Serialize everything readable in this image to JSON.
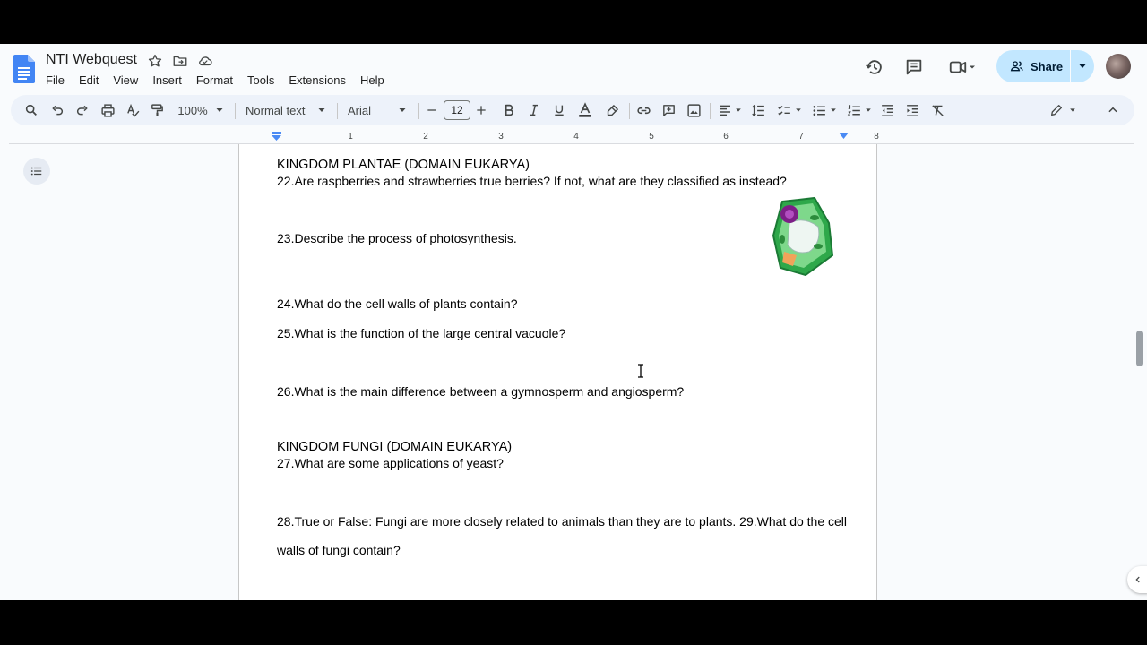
{
  "document": {
    "title": "NTI Webquest"
  },
  "menu": [
    "File",
    "Edit",
    "View",
    "Insert",
    "Format",
    "Tools",
    "Extensions",
    "Help"
  ],
  "header": {
    "share_label": "Share"
  },
  "toolbar": {
    "zoom": "100%",
    "style": "Normal text",
    "font": "Arial",
    "font_size": "12"
  },
  "ruler": {
    "labels": [
      "1",
      "2",
      "3",
      "4",
      "5",
      "6",
      "7",
      "8"
    ]
  },
  "content": {
    "plantae_heading": "KINGDOM PLANTAE (DOMAIN EUKARYA)",
    "q22": "22.Are raspberries and strawberries true berries? If not, what are they classified as instead?",
    "q23": "23.Describe the process of photosynthesis.",
    "q24": "24.What do the cell walls of plants contain?",
    "q25": "25.What is the function of the large central vacuole?",
    "q26": "26.What is the main difference between a gymnosperm and angiosperm?",
    "fungi_heading": "KINGDOM FUNGI (DOMAIN EUKARYA)",
    "q27": "27.What are some applications of yeast?",
    "q28_29_line1": "28.True or False: Fungi are more closely related to animals than they are to plants.  29.What do the cell",
    "q28_29_line2": "walls of fungi contain?"
  },
  "colors": {
    "accent": "#0b57d0",
    "share_bg": "#c2e7ff",
    "toolbar_bg": "#edf2fa"
  }
}
